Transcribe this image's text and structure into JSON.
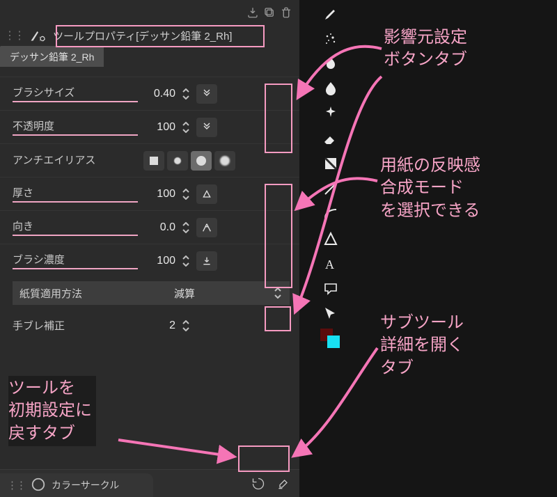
{
  "header": {
    "title": "ツールプロパティ[デッサン鉛筆 2_Rh]",
    "tab_label": "デッサン鉛筆 2_Rh"
  },
  "props": {
    "brush_size": {
      "label": "ブラシサイズ",
      "value": "0.40"
    },
    "opacity": {
      "label": "不透明度",
      "value": "100"
    },
    "antialias": {
      "label": "アンチエイリアス"
    },
    "thickness": {
      "label": "厚さ",
      "value": "100"
    },
    "direction": {
      "label": "向き",
      "value": "0.0"
    },
    "density": {
      "label": "ブラシ濃度",
      "value": "100"
    },
    "paper_mode": {
      "label": "紙質適用方法",
      "value": "減算"
    },
    "stabilize": {
      "label": "手ブレ補正",
      "value": "2"
    }
  },
  "footer": {
    "color_circle_label": "カラーサークル"
  },
  "annotations": {
    "top": "影響元設定\nボタンタブ",
    "mid": "用紙の反映感\n合成モード\nを選択できる",
    "sub": "サブツール\n詳細を開く\nタブ",
    "left": "ツールを\n初期設定に\n戻すタブ"
  }
}
